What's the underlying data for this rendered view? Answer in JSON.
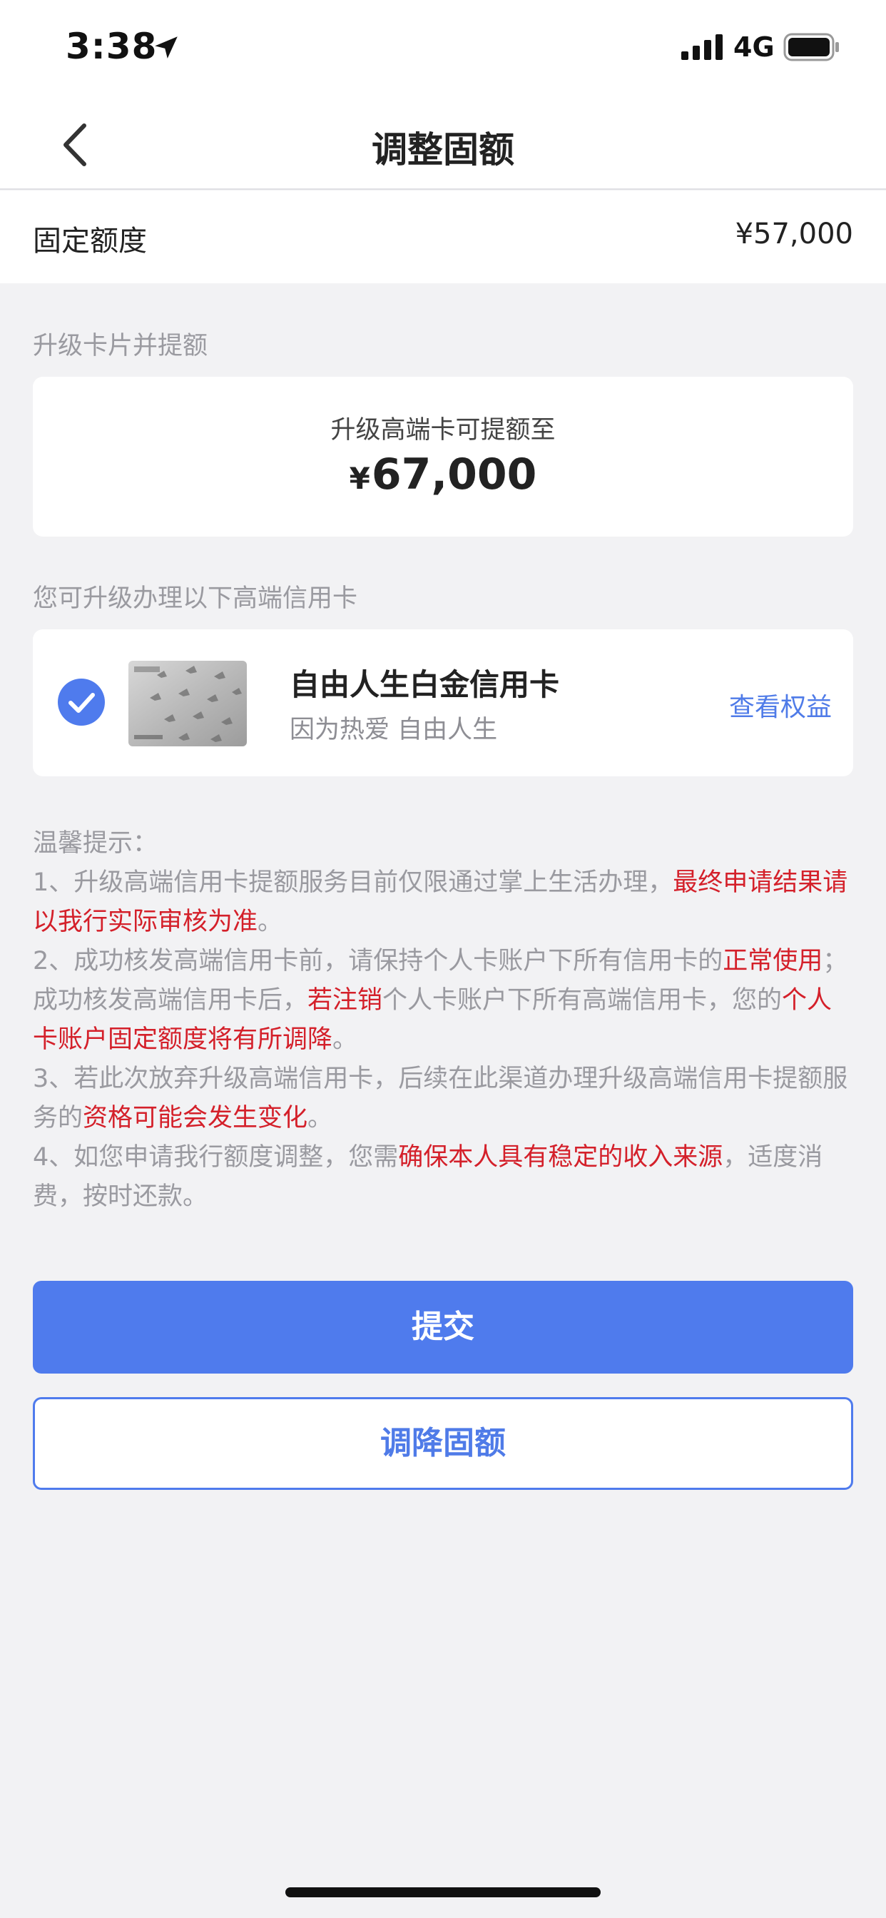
{
  "status_bar": {
    "time": "3:38",
    "network": "4G",
    "icons": [
      "location-arrow-icon",
      "signal-bars-icon",
      "battery-icon"
    ]
  },
  "nav": {
    "title": "调整固额",
    "back_icon": "chevron-left-icon"
  },
  "fixed_limit": {
    "label": "固定额度",
    "value": "¥57,000"
  },
  "upgrade_section": {
    "label": "升级卡片并提额",
    "subtitle": "升级高端卡可提额至",
    "currency": "¥",
    "amount": "67,000"
  },
  "card_section": {
    "label": "您可升级办理以下高端信用卡",
    "card": {
      "name": "自由人生白金信用卡",
      "slogan": "因为热爱 自由人生",
      "link": "查看权益",
      "selected": true,
      "check_icon": "check-circle-icon",
      "image_icon": "credit-card-image"
    }
  },
  "tips": {
    "title": "温馨提示：",
    "items": [
      {
        "normal1": "1、升级高端信用卡提额服务目前仅限通过掌上生活办理，",
        "red1": "最终申请结果请以我行实际审核为准",
        "normal2": "。"
      },
      {
        "normal1": "2、成功核发高端信用卡前，请保持个人卡账户下所有信用卡的",
        "red1": "正常使用",
        "normal2": "；成功核发高端信用卡后，",
        "red2": "若注销",
        "normal3": "个人卡账户下所有高端信用卡，您的",
        "red3": "个人卡账户固定额度将有所调降",
        "normal4": "。"
      },
      {
        "normal1": "3、若此次放弃升级高端信用卡，后续在此渠道办理升级高端信用卡提额服务的",
        "red1": "资格可能会发生变化",
        "normal2": "。"
      },
      {
        "normal1": "4、如您申请我行额度调整，您需",
        "red1": "确保本人具有稳定的收入来源",
        "normal2": "，适度消费，按时还款。"
      }
    ]
  },
  "buttons": {
    "submit": "提交",
    "reduce": "调降固额"
  },
  "colors": {
    "primary": "#4f7bed",
    "highlight_red": "#d4202a",
    "background": "#f2f2f4"
  }
}
